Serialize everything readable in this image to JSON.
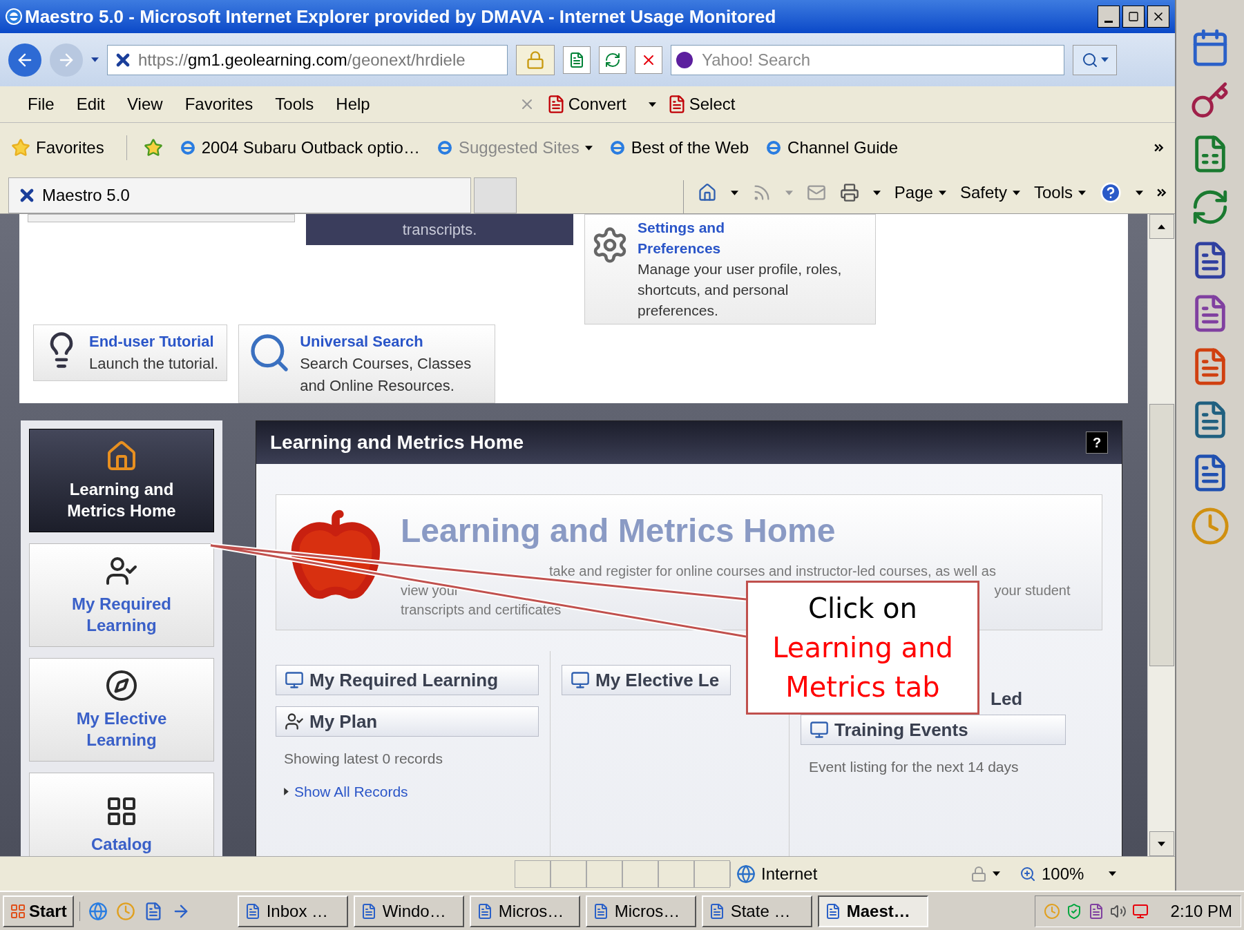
{
  "window": {
    "title": "Maestro 5.0 - Microsoft Internet Explorer provided by DMAVA - Internet Usage Monitored"
  },
  "address_bar": {
    "scheme": "https://",
    "host": "gm1.geolearning.com",
    "path": "/geonext/hrdiele"
  },
  "search": {
    "placeholder": "Yahoo! Search"
  },
  "menu": [
    "File",
    "Edit",
    "View",
    "Favorites",
    "Tools",
    "Help"
  ],
  "toolbar_buttons": [
    "Convert",
    "Select"
  ],
  "favorites_bar": {
    "label": "Favorites",
    "links": [
      {
        "label": "2004 Subaru Outback optio…",
        "dimmed": false,
        "menu": false
      },
      {
        "label": "Suggested Sites",
        "dimmed": true,
        "menu": true
      },
      {
        "label": "Best of the Web",
        "dimmed": false,
        "menu": false
      },
      {
        "label": "Channel Guide",
        "dimmed": false,
        "menu": false
      }
    ]
  },
  "tabs": [
    {
      "label": "Maestro 5.0",
      "selected": true
    }
  ],
  "command_bar": [
    "Page",
    "Safety",
    "Tools"
  ],
  "top_cards": {
    "dark_card_text": "transcripts.",
    "settings": {
      "title_lines": [
        "Settings and",
        "Preferences"
      ],
      "description": "Manage your user profile, roles, shortcuts, and personal preferences."
    },
    "quick_links": [
      {
        "title": "End-user Tutorial",
        "description": "Launch the tutorial."
      },
      {
        "title": "Universal Search",
        "description": "Search Courses, Classes and Online Resources."
      }
    ]
  },
  "nav": [
    {
      "label": "Learning and Metrics Home",
      "selected": true
    },
    {
      "label": "My Required Learning",
      "selected": false
    },
    {
      "label": "My Elective Learning",
      "selected": false
    },
    {
      "label": "Catalog",
      "selected": false
    }
  ],
  "panel": {
    "title": "Learning and Metrics Home",
    "help": "?",
    "hero_title": "Learning and Metrics Home",
    "description_lines": [
      "take and register for online courses and instructor-led courses, as well as",
      "view your",
      "your student",
      "transcripts and certificates"
    ],
    "required": {
      "title": "My Required Learning"
    },
    "plan": {
      "title": "My Plan",
      "note": "Showing latest 0 records",
      "link": "Show All Records"
    },
    "elective": {
      "title": "My Elective Le"
    },
    "events": {
      "title_lines": [
        "Led",
        "Training Events"
      ],
      "note": "Event listing for the next 14 days"
    }
  },
  "status_bar": {
    "zone": "Internet",
    "zoom": "100%"
  },
  "taskbar": {
    "start": "Start",
    "tasks": [
      {
        "label": "Inbox …",
        "selected": false
      },
      {
        "label": "Windo…",
        "selected": false
      },
      {
        "label": "Micros…",
        "selected": false
      },
      {
        "label": "Micros…",
        "selected": false
      },
      {
        "label": "State …",
        "selected": false
      },
      {
        "label": "Maest…",
        "selected": true
      }
    ],
    "clock": "2:10 PM"
  },
  "callout": {
    "lead": "Click on",
    "highlight": "Learning and Metrics tab"
  }
}
